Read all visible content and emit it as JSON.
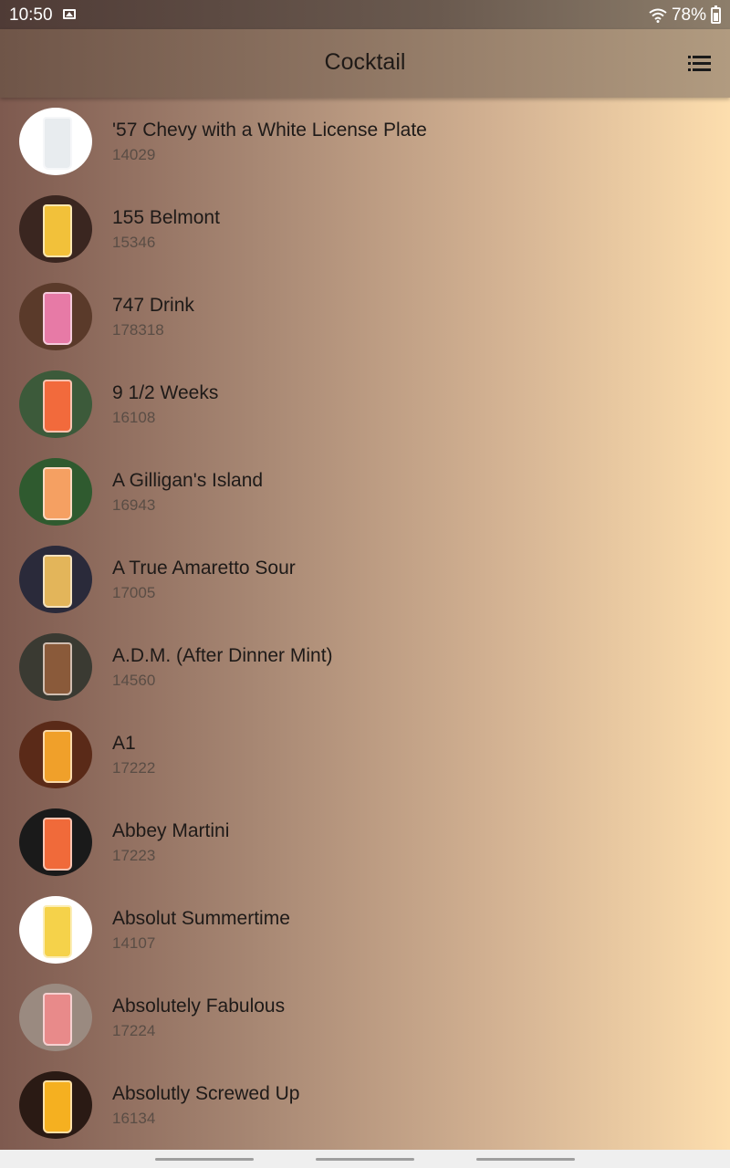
{
  "status": {
    "time": "10:50",
    "battery": "78%"
  },
  "header": {
    "title": "Cocktail",
    "menu_icon": "list-icon"
  },
  "drinks": [
    {
      "name": "'57 Chevy with a White License Plate",
      "id": "14029",
      "thumb_bg": "#ffffff",
      "glass": "#e8ecef"
    },
    {
      "name": "155 Belmont",
      "id": "15346",
      "thumb_bg": "#3a2620",
      "glass": "#f2c13a"
    },
    {
      "name": "747 Drink",
      "id": "178318",
      "thumb_bg": "#5a3a2a",
      "glass": "#e77aa6"
    },
    {
      "name": "9 1/2 Weeks",
      "id": "16108",
      "thumb_bg": "#3c5a3a",
      "glass": "#f26a3c"
    },
    {
      "name": "A Gilligan's Island",
      "id": "16943",
      "thumb_bg": "#2f5a2f",
      "glass": "#f5a062"
    },
    {
      "name": "A True Amaretto Sour",
      "id": "17005",
      "thumb_bg": "#2a2a3a",
      "glass": "#e3b55a"
    },
    {
      "name": "A.D.M. (After Dinner Mint)",
      "id": "14560",
      "thumb_bg": "#3a3a32",
      "glass": "#8a5a3a"
    },
    {
      "name": "A1",
      "id": "17222",
      "thumb_bg": "#5a2a18",
      "glass": "#f0a02a"
    },
    {
      "name": "Abbey Martini",
      "id": "17223",
      "thumb_bg": "#1a1a1a",
      "glass": "#f06a3a"
    },
    {
      "name": "Absolut Summertime",
      "id": "14107",
      "thumb_bg": "#ffffff",
      "glass": "#f5d24a"
    },
    {
      "name": "Absolutely Fabulous",
      "id": "17224",
      "thumb_bg": "#9a8a80",
      "glass": "#e88a8a"
    },
    {
      "name": "Absolutly Screwed Up",
      "id": "16134",
      "thumb_bg": "#2a1a14",
      "glass": "#f5b020"
    }
  ]
}
